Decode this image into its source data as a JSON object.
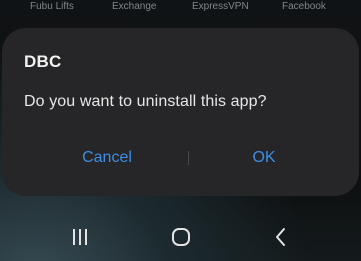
{
  "home_screen": {
    "app_labels": [
      "Fubu Lifts",
      "Exchange",
      "ExpressVPN",
      "Facebook"
    ]
  },
  "dialog": {
    "title": "DBC",
    "message": "Do you want to uninstall this app?",
    "cancel_label": "Cancel",
    "ok_label": "OK"
  },
  "nav_bar": {
    "icons": [
      "recent-apps-icon",
      "home-icon",
      "back-icon"
    ]
  },
  "colors": {
    "dialog_background": "#262628",
    "accent": "#3d8ee6",
    "text_primary": "#f1f1f1"
  }
}
